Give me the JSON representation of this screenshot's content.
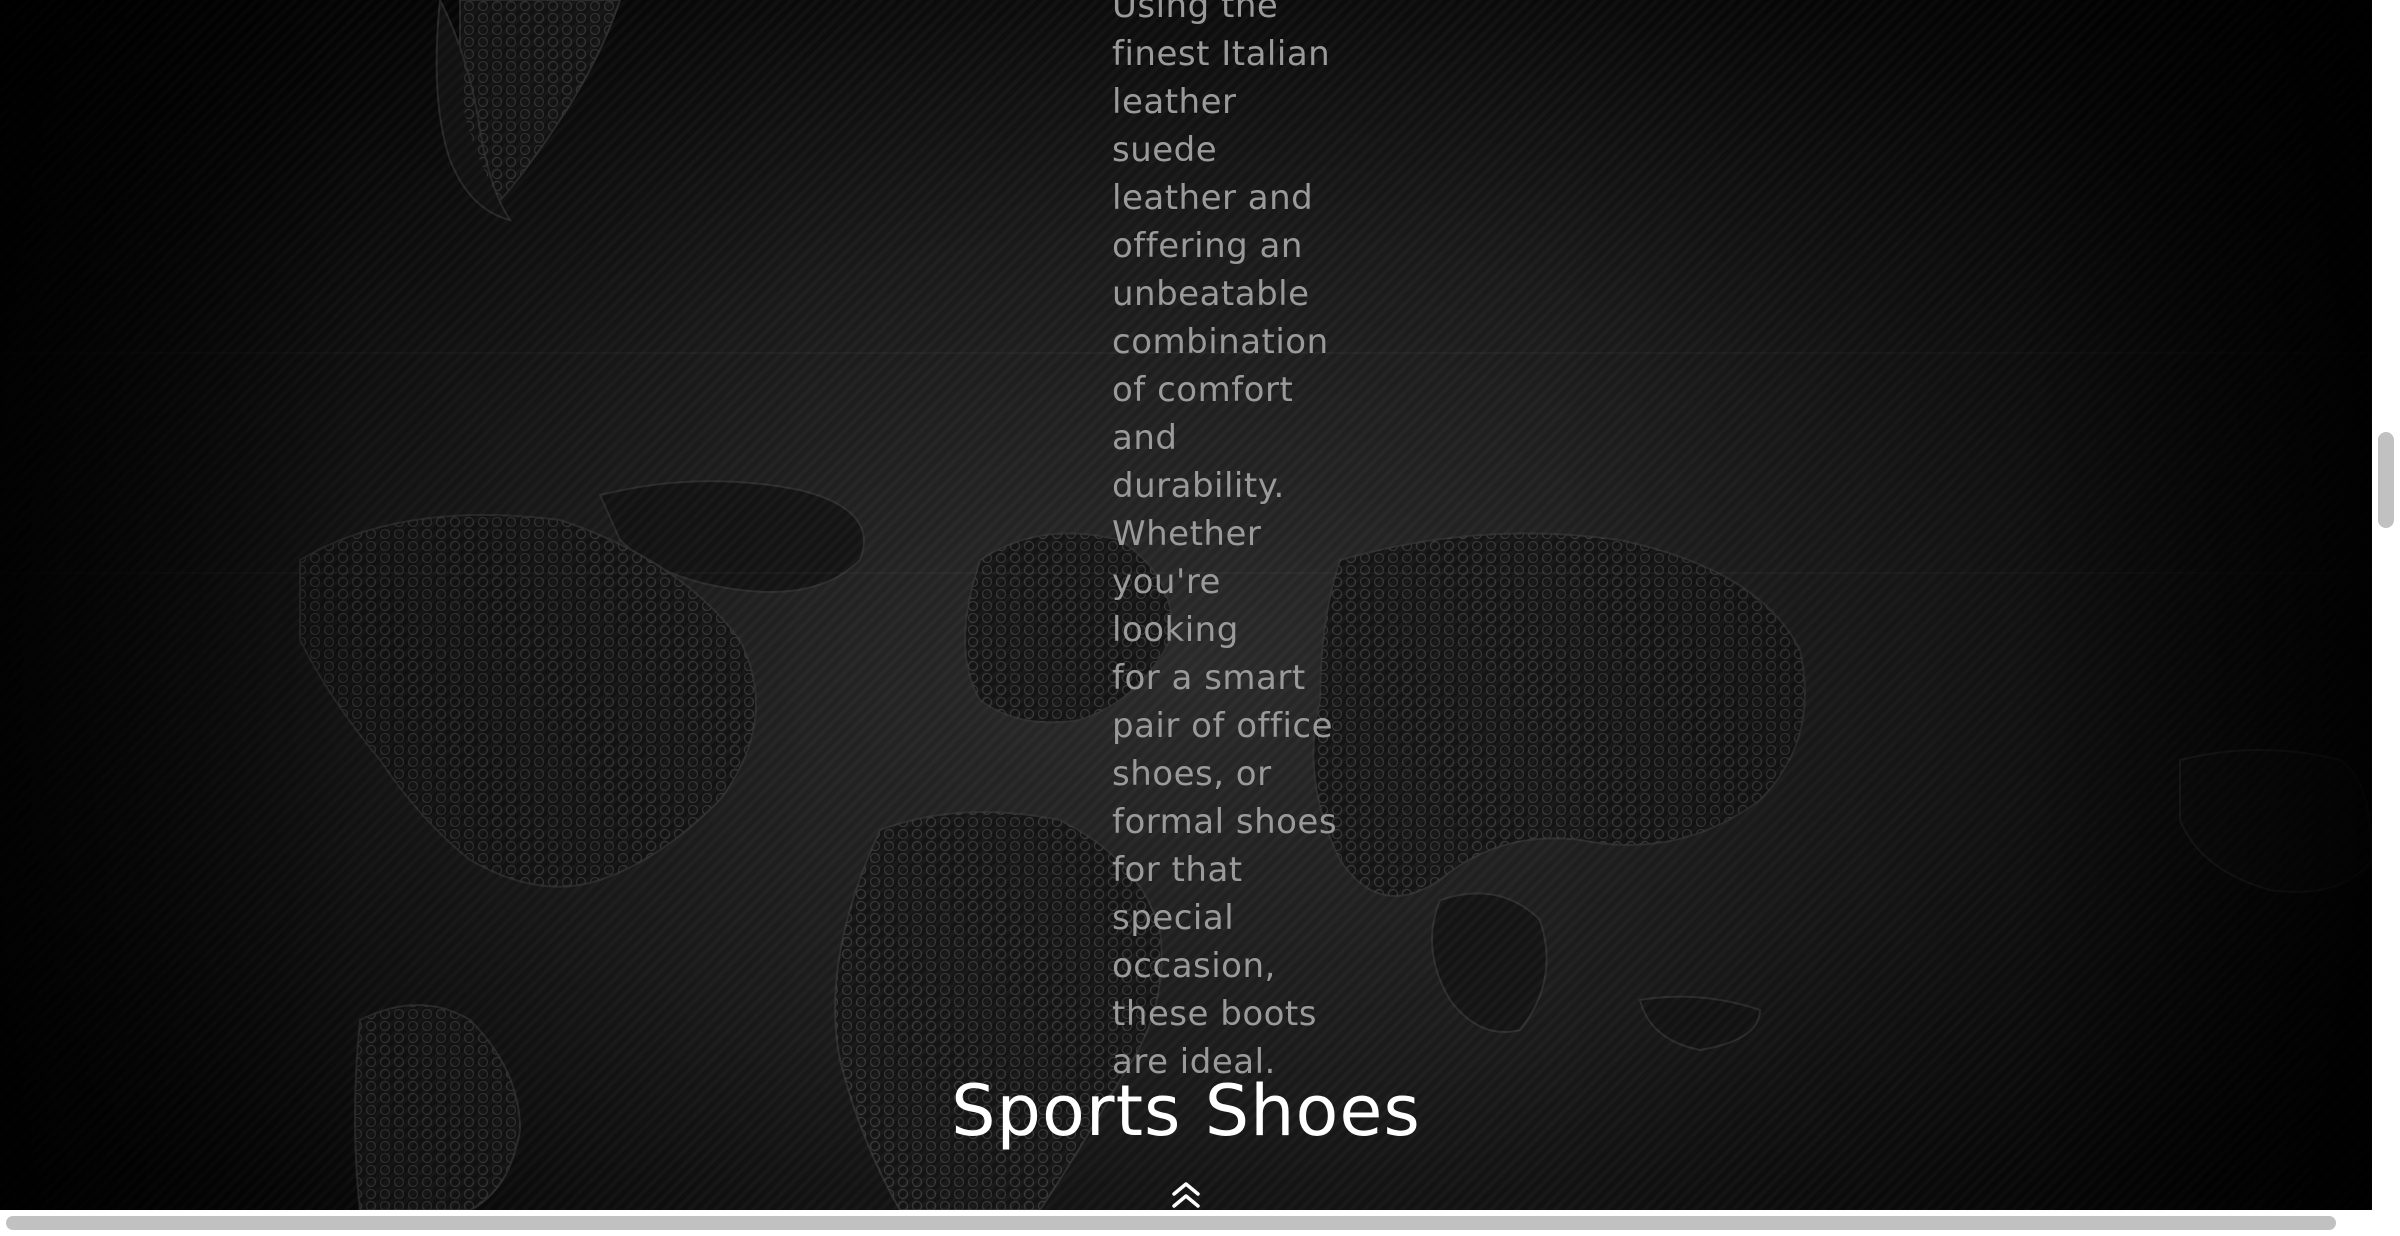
{
  "content": {
    "description_lines": [
      "Using the",
      "finest Italian",
      "leather suede",
      "leather and",
      "offering an",
      "unbeatable",
      "combination",
      "of comfort",
      "and",
      "durability.",
      "Whether",
      "you're looking",
      "for a smart",
      "pair of office",
      "shoes, or",
      "formal shoes",
      "for that",
      "special",
      "occasion,",
      "these boots",
      "are ideal."
    ],
    "section_title": "Sports Shoes"
  },
  "controls": {
    "scroll_top_icon": "double-chevron-up-icon"
  },
  "colors": {
    "background": "#000000",
    "body_text": "#9a9a9a",
    "heading": "#ffffff",
    "scrollbar_thumb": "#c1c1c1"
  }
}
